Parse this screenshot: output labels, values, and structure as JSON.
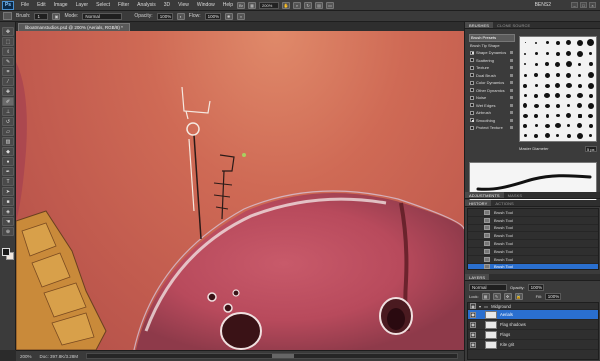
{
  "menubar": {
    "app_badge": "Ps",
    "items": [
      "File",
      "Edit",
      "Image",
      "Layer",
      "Select",
      "Filter",
      "Analysis",
      "3D",
      "View",
      "Window",
      "Help"
    ],
    "zoom": "200%",
    "workspace": "BENS2"
  },
  "options": {
    "brush_label": "Brush:",
    "brush_size": "1",
    "mode_label": "Mode:",
    "mode_value": "Normal",
    "opacity_label": "Opacity:",
    "opacity_value": "100%",
    "flow_label": "Flow:",
    "flow_value": "100%"
  },
  "document": {
    "tab_title": "liboatmanstudios.psd @ 200% (Aerials, RGB/8) *",
    "status_zoom": "200%",
    "status_doc": "Doc: 397.8K/3.28M"
  },
  "brushes_panel": {
    "tabs": [
      "BRUSHES",
      "CLONE SOURCE"
    ],
    "preset_button": "Brush Presets",
    "options": [
      {
        "label": "Brush Tip Shape",
        "on": false,
        "header": true
      },
      {
        "label": "Shape Dynamics",
        "on": true
      },
      {
        "label": "Scattering",
        "on": false
      },
      {
        "label": "Texture",
        "on": false
      },
      {
        "label": "Dual Brush",
        "on": false
      },
      {
        "label": "Color Dynamics",
        "on": false
      },
      {
        "label": "Other Dynamics",
        "on": false
      },
      {
        "label": "Noise",
        "on": false
      },
      {
        "label": "Wet Edges",
        "on": false
      },
      {
        "label": "Airbrush",
        "on": false
      },
      {
        "label": "Smoothing",
        "on": true
      },
      {
        "label": "Protect Texture",
        "on": false
      }
    ],
    "master_diameter_label": "Master Diameter",
    "master_diameter_value": "5 px"
  },
  "adjustments": {
    "tabs": [
      "ADJUSTMENTS",
      "MASKS"
    ]
  },
  "history_panel": {
    "tabs": [
      "HISTORY",
      "ACTIONS"
    ],
    "items": [
      "Brush Tool",
      "Brush Tool",
      "Brush Tool",
      "Brush Tool",
      "Brush Tool",
      "Brush Tool",
      "Brush Tool",
      "Brush Tool",
      "Brush Tool"
    ],
    "selected_index": 8
  },
  "layers_panel": {
    "tab": "LAYERS",
    "blend_mode": "Normal",
    "opacity_label": "Opacity:",
    "opacity_value": "100%",
    "lock_label": "Lock:",
    "fill_label": "Fill:",
    "fill_value": "100%",
    "group_name": "Midground",
    "layers": [
      {
        "name": "Aerials",
        "selected": true
      },
      {
        "name": "Flag shadows",
        "selected": false
      },
      {
        "name": "Flags",
        "selected": false
      },
      {
        "name": "Kite grit",
        "selected": false
      }
    ]
  }
}
